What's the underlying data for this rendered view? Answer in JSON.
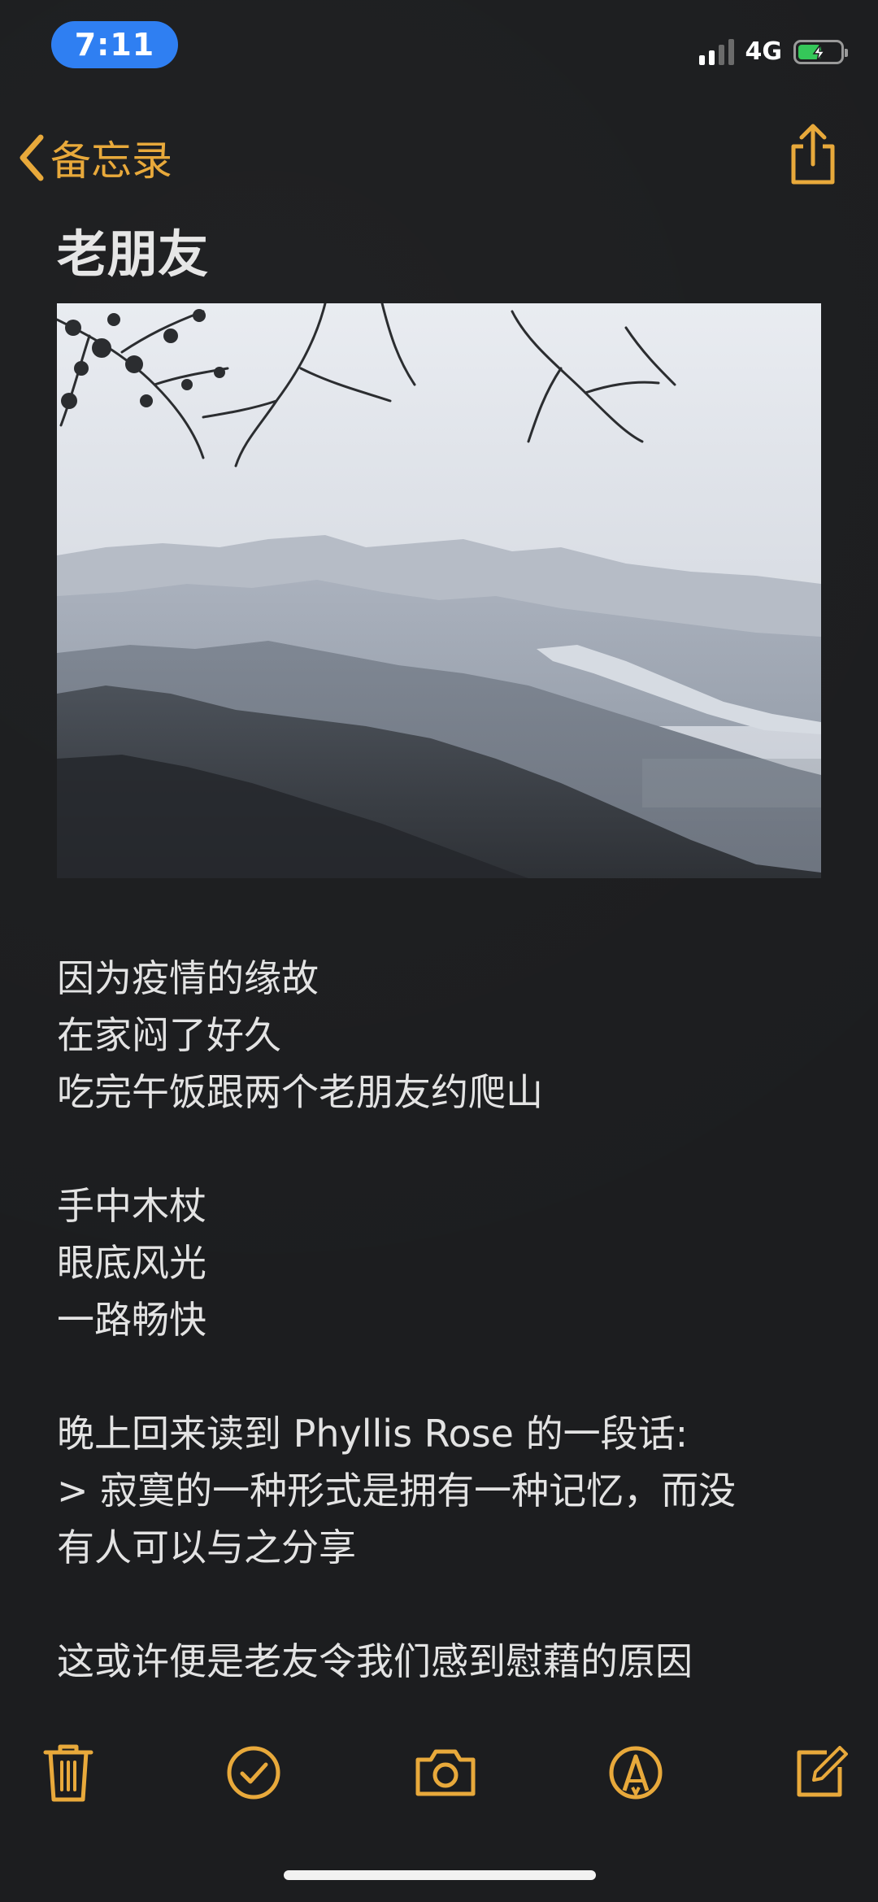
{
  "status_bar": {
    "time": "7:11",
    "network": "4G",
    "battery_charging": true
  },
  "nav": {
    "back_label": "备忘录",
    "back_icon": "chevron-left-icon",
    "share_icon": "share-icon"
  },
  "note": {
    "title": "老朋友",
    "photo_description_icon": "landscape-photo",
    "lines": [
      "因为疫情的缘故",
      "在家闷了好久",
      "吃完午饭跟两个老朋友约爬山",
      "",
      "手中木杖",
      "眼底风光",
      "一路畅快",
      "",
      "晚上回来读到 Phyllis Rose 的一段话:",
      ">  寂寞的一种形式是拥有一种记忆，而没",
      "有人可以与之分享",
      "",
      "这或许便是老友令我们感到慰藉的原因"
    ]
  },
  "toolbar": {
    "items": [
      "trash-icon",
      "checklist-icon",
      "camera-icon",
      "markup-icon",
      "compose-icon"
    ]
  },
  "colors": {
    "accent": "#e8a93b",
    "background": "#1c1d1f",
    "time_pill": "#2f7ff2",
    "text": "#e3e3e3"
  }
}
